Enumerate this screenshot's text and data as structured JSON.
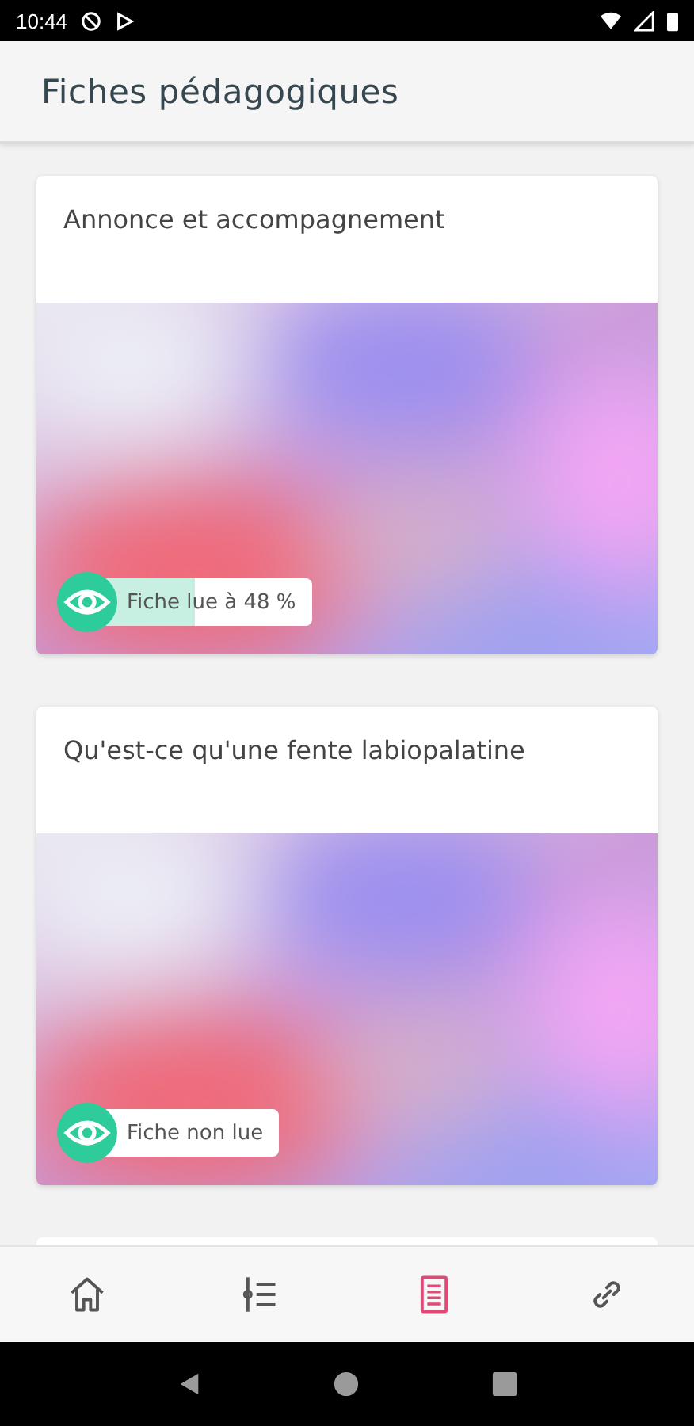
{
  "status_bar": {
    "time": "10:44"
  },
  "app_bar": {
    "title": "Fiches pédagogiques"
  },
  "cards": [
    {
      "title": "Annonce et accompagnement",
      "progress": {
        "label": "Fiche lue à 48 %",
        "level": 0.48
      }
    },
    {
      "title": "Qu'est-ce qu'une fente labiopalatine",
      "progress": {
        "label": "Fiche non lue",
        "level": 0
      }
    }
  ],
  "bottom_nav": [
    {
      "kind": "home",
      "selected": false
    },
    {
      "kind": "steps",
      "selected": false
    },
    {
      "kind": "document",
      "selected": true
    },
    {
      "kind": "link",
      "selected": false
    }
  ]
}
